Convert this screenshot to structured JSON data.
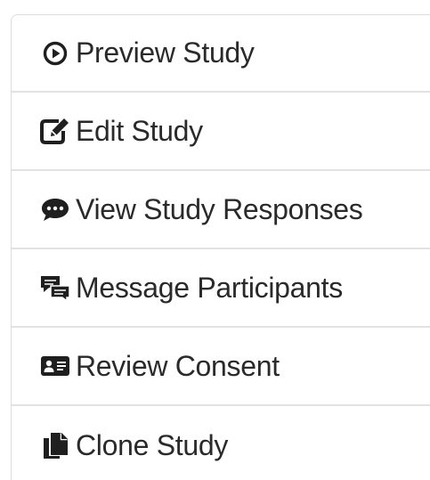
{
  "menu": {
    "items": [
      {
        "label": "Preview Study",
        "icon": "play-circle-icon"
      },
      {
        "label": "Edit Study",
        "icon": "edit-icon"
      },
      {
        "label": "View Study Responses",
        "icon": "comment-icon"
      },
      {
        "label": "Message Participants",
        "icon": "message-participants-icon"
      },
      {
        "label": "Review Consent",
        "icon": "id-card-icon"
      },
      {
        "label": "Clone Study",
        "icon": "copy-icon"
      }
    ]
  }
}
